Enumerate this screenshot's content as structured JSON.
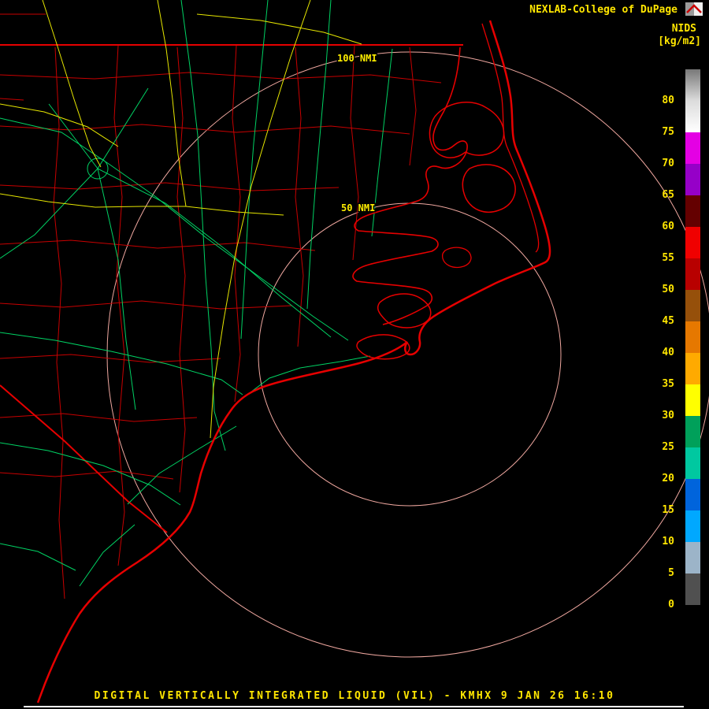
{
  "header": {
    "brand": "NEXLAB-College of DuPage",
    "logo_icon": "nexlab-flag-icon",
    "product": "NIDS",
    "units": "[kg/m2]"
  },
  "colorbar": {
    "tick_labels": [
      "80",
      "75",
      "70",
      "65",
      "60",
      "55",
      "50",
      "45",
      "40",
      "35",
      "30",
      "25",
      "20",
      "15",
      "10",
      "5",
      "0"
    ],
    "segments": [
      {
        "range": "above-80",
        "color": "#787878",
        "color2": "#dcdcdc",
        "gradient": true
      },
      {
        "range": "75-80",
        "color": "#dcdcdc",
        "color2": "#ffffff",
        "gradient": true
      },
      {
        "range": "70-75",
        "color": "#e400e4"
      },
      {
        "range": "65-70",
        "color": "#9600c8"
      },
      {
        "range": "60-65",
        "color": "#640000"
      },
      {
        "range": "55-60",
        "color": "#f00000"
      },
      {
        "range": "50-55",
        "color": "#b80000"
      },
      {
        "range": "45-50",
        "color": "#96500a"
      },
      {
        "range": "40-45",
        "color": "#e67800"
      },
      {
        "range": "35-40",
        "color": "#ffaa00"
      },
      {
        "range": "30-35",
        "color": "#ffff00"
      },
      {
        "range": "25-30",
        "color": "#00a05a"
      },
      {
        "range": "20-25",
        "color": "#00c8a0"
      },
      {
        "range": "15-20",
        "color": "#0064dc"
      },
      {
        "range": "10-15",
        "color": "#00a8ff"
      },
      {
        "range": "5-10",
        "color": "#9cb4c8"
      },
      {
        "range": "0-5",
        "color": "#505050"
      },
      {
        "range": "below-0",
        "color": "#000000"
      }
    ]
  },
  "map": {
    "station": "KMHX",
    "range_rings": [
      {
        "label": "100 NMI"
      },
      {
        "label": "50 NMI"
      }
    ],
    "colors": {
      "coastline": "#e60000",
      "county_border": "#c80000",
      "state_border": "#e60000",
      "road_primary": "#00d264",
      "road_secondary": "#e6e600",
      "range_ring": "#f0a8a0",
      "ring_label": "#ffee00",
      "text_yellow": "#ffe600"
    }
  },
  "footer": {
    "title": "DIGITAL VERTICALLY INTEGRATED LIQUID (VIL) - KMHX 9 JAN 26 16:10"
  }
}
